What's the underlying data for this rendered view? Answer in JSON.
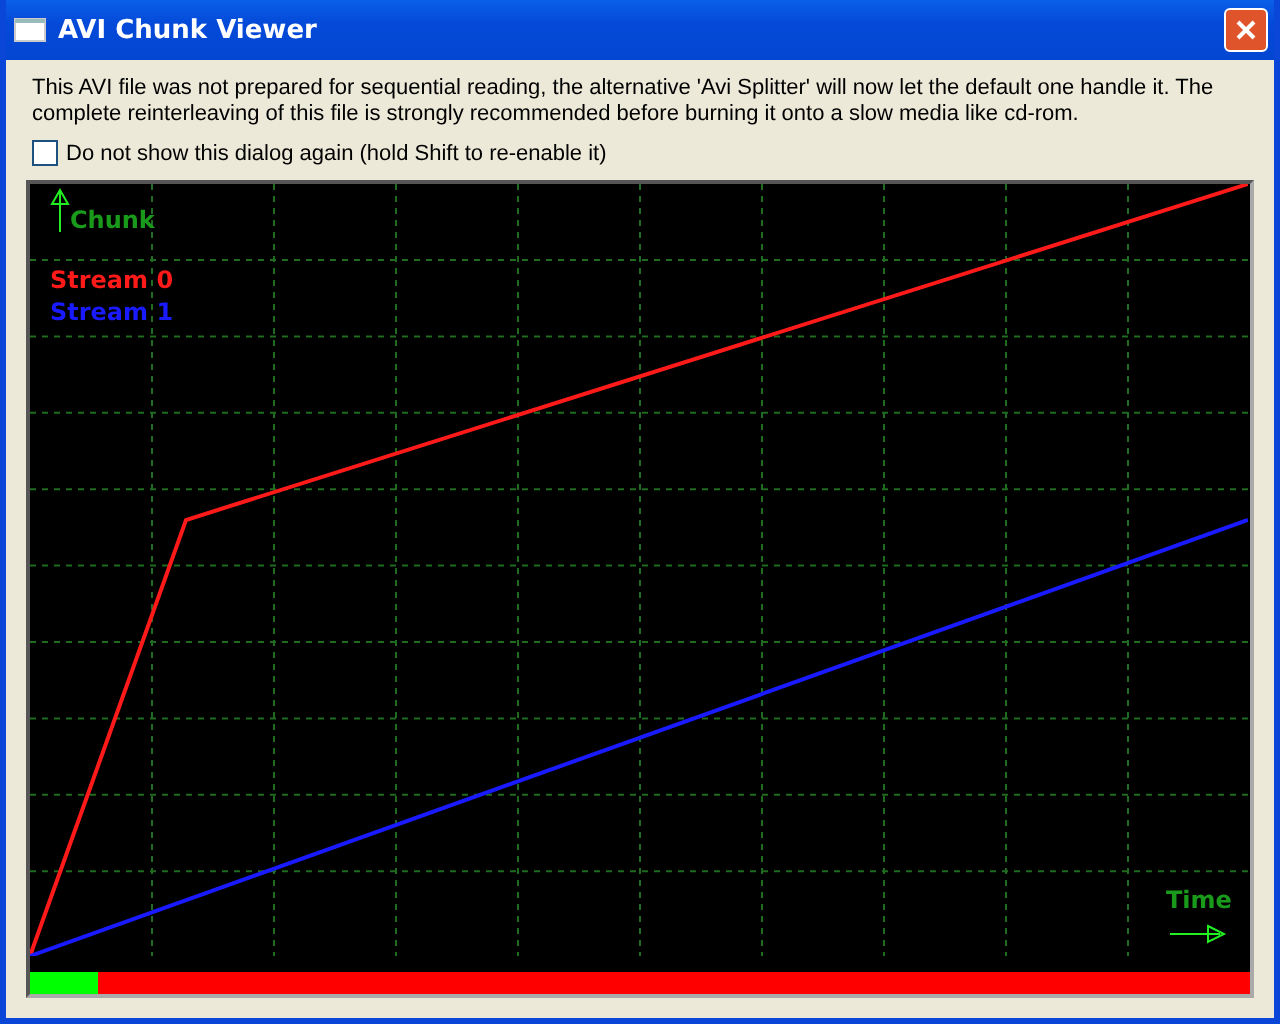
{
  "window": {
    "title": "AVI Chunk Viewer"
  },
  "message": "This AVI file was not prepared for sequential reading, the alternative 'Avi Splitter' will now let the default one handle it. The complete reinterleaving of this file is strongly recommended before burning it onto a slow media like cd-rom.",
  "dont_show_again": {
    "label": "Do not show this dialog again (hold Shift to re-enable it)",
    "checked": false
  },
  "plot": {
    "y_axis_label": "Chunk",
    "x_axis_label": "Time",
    "legend": [
      {
        "label": "Stream 0",
        "color": "#ff1a1a"
      },
      {
        "label": "Stream 1",
        "color": "#1a1aff"
      }
    ]
  },
  "progress": {
    "level": 0.055
  }
}
